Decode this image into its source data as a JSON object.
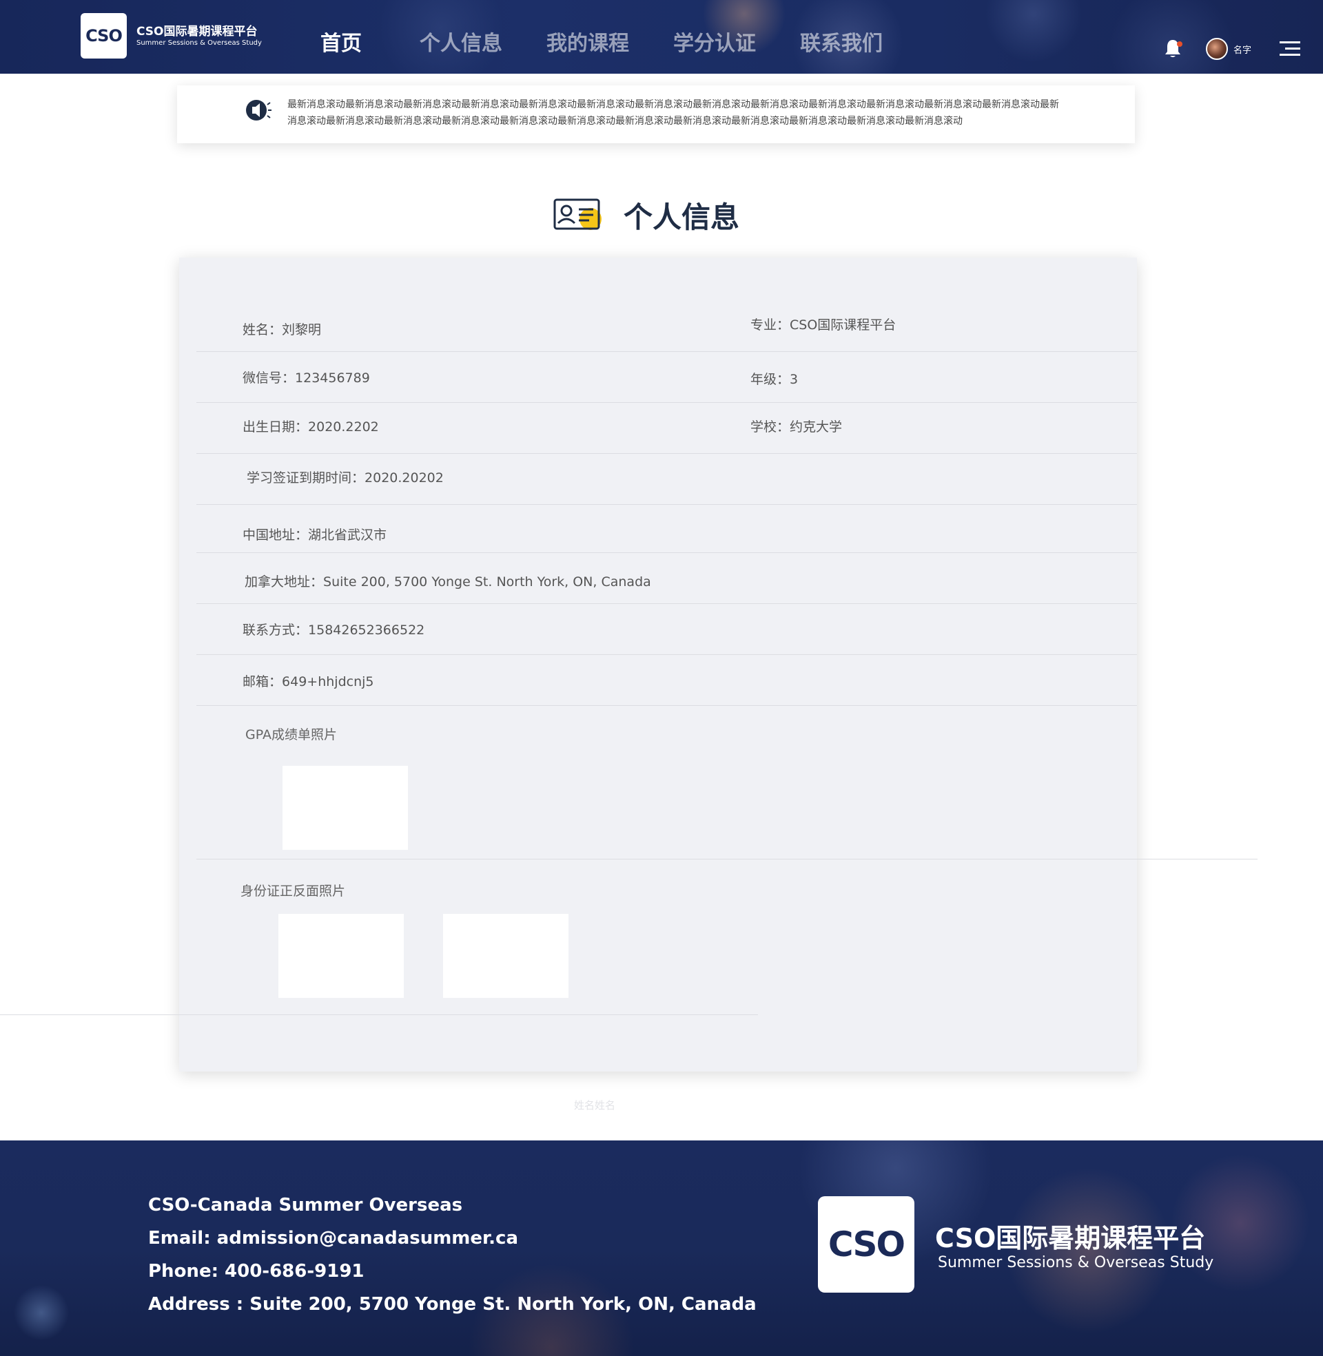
{
  "header": {
    "logo_mark": "CSO",
    "logo_cn": "CSO国际暑期课程平台",
    "logo_en": "Summer Sessions & Overseas Study",
    "nav": [
      {
        "label": "首页",
        "active": true
      },
      {
        "label": "个人信息",
        "active": false
      },
      {
        "label": "我的课程",
        "active": false
      },
      {
        "label": "学分认证",
        "active": false
      },
      {
        "label": "联系我们",
        "active": false
      }
    ],
    "username": "名字",
    "icons": {
      "notification": "bell-icon",
      "avatar": "avatar",
      "menu": "menu-icon"
    },
    "notification_dot_color": "#e8502a"
  },
  "notice": {
    "icon": "speaker-icon",
    "text": "最新消息滚动最新消息滚动最新消息滚动最新消息滚动最新消息滚动最新消息滚动最新消息滚动最新消息滚动最新消息滚动最新消息滚动最新消息滚动最新消息滚动最新消息滚动最新消息滚动最新消息滚动最新消息滚动最新消息滚动最新消息滚动最新消息滚动最新消息滚动最新消息滚动最新消息滚动最新消息滚动最新消息滚动最新消息滚动"
  },
  "section": {
    "title": "个人信息",
    "icon": "id-card-icon",
    "icon_accent": "#f5c518"
  },
  "info": {
    "name_label": "姓名：",
    "name": "刘黎明",
    "major_label": "专业：",
    "major": "CSO国际课程平台",
    "wechat_label": "微信号：",
    "wechat": "123456789",
    "grade_label": "年级：",
    "grade": "3",
    "birth_label": "出生日期：",
    "birth": "2020.2202",
    "school_label": "学校：",
    "school": "约克大学",
    "visa_label": "学习签证到期时间：",
    "visa": "2020.20202",
    "cn_address_label": "中国地址：",
    "cn_address": "湖北省武汉市",
    "ca_address_label": "加拿大地址：",
    "ca_address": "Suite 200, 5700 Yonge St. North York, ON, Canada",
    "contact_label": "联系方式：",
    "contact": "15842652366522",
    "email_label": "邮箱：",
    "email": "649+hhjdcnj5",
    "gpa_label": "GPA成绩单照片",
    "id_label": "身份证正反面照片"
  },
  "bottom_caption": "姓名姓名",
  "footer": {
    "line1": "CSO-Canada Summer Overseas",
    "line2": "Email: admission@canadasummer.ca",
    "line3": "Phone: 400-686-9191",
    "line4": "Address : Suite 200, 5700 Yonge St. North York, ON, Canada",
    "logo_mark": "CSO",
    "logo_cn": "CSO国际暑期课程平台",
    "logo_en": "Summer Sessions & Overseas Study"
  },
  "colors": {
    "header_bg": "#1b2c63",
    "card_bg": "#f0f1f5",
    "title_text": "#1f2d45"
  }
}
